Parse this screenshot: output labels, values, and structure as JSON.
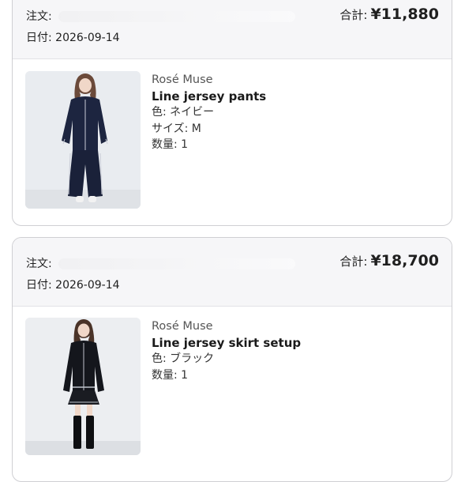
{
  "orders": [
    {
      "order_label": "注文:",
      "date_label": "日付:",
      "date": "2026-09-14",
      "total_label": "合計:",
      "total": "¥11,880",
      "item": {
        "brand": "Rosé Muse",
        "name": "Line jersey pants",
        "color": "色: ネイビー",
        "size": "サイズ: M",
        "quantity": "数量: 1"
      }
    },
    {
      "order_label": "注文:",
      "date_label": "日付:",
      "date": "2026-09-14",
      "total_label": "合計:",
      "total": "¥18,700",
      "item": {
        "brand": "Rosé Muse",
        "name": "Line jersey skirt setup",
        "color": "色: ブラック",
        "quantity": "数量: 1"
      }
    }
  ]
}
